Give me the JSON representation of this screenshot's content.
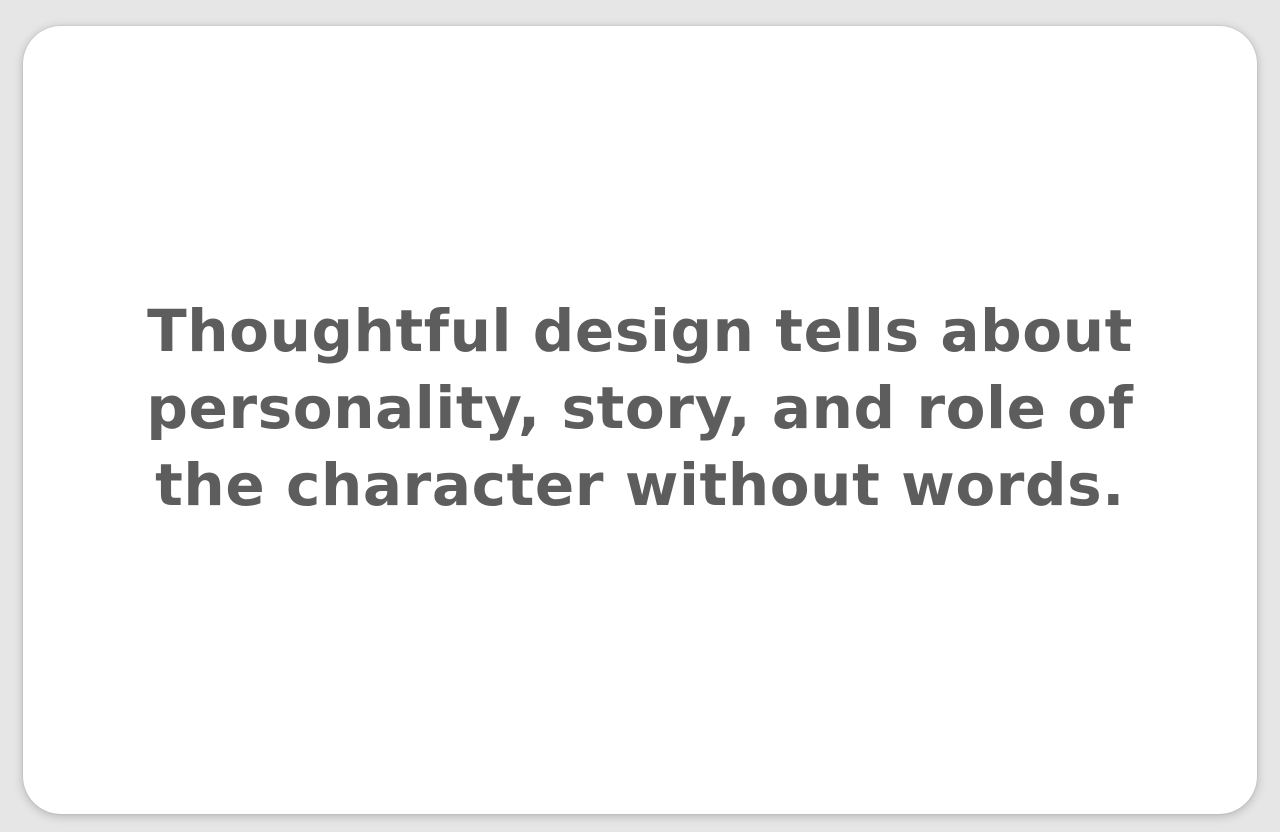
{
  "card": {
    "lines": [
      "Thoughtful design tells about",
      "personality, story, and role of",
      "the character without words."
    ]
  },
  "colors": {
    "background": "#e6e6e6",
    "card": "#ffffff",
    "text": "#5d5d5d"
  }
}
